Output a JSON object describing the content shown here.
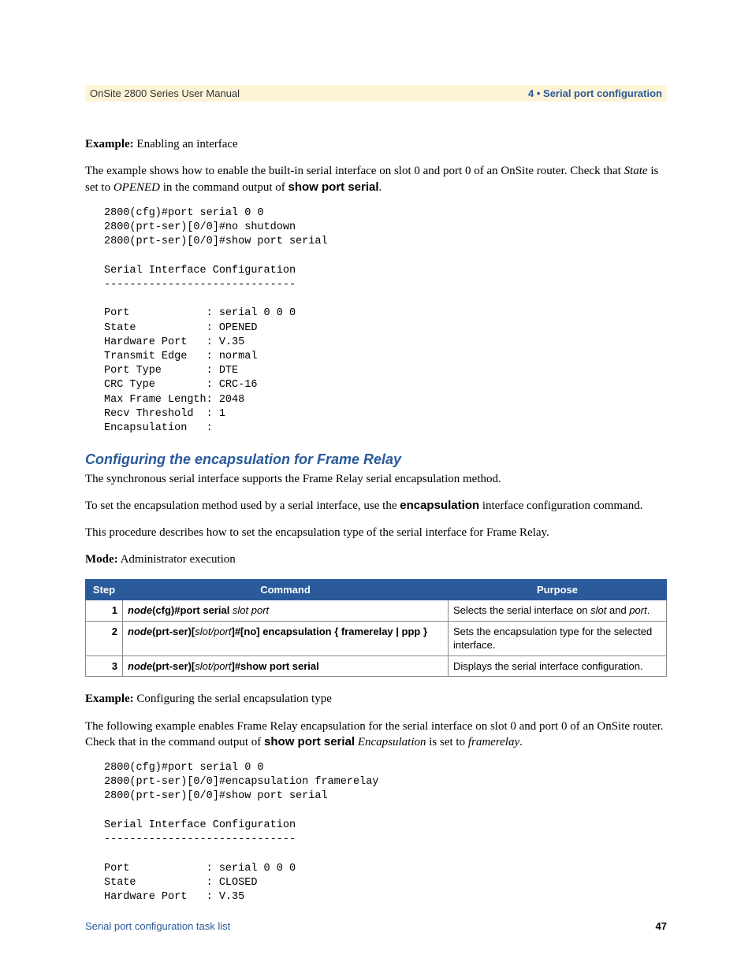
{
  "header": {
    "left": "OnSite 2800 Series User Manual",
    "right": "4 • Serial port configuration"
  },
  "example1": {
    "label": "Example:",
    "title": " Enabling an interface",
    "intro_a": "The example shows how to enable the built-in serial interface on slot 0 and port 0 of an OnSite router. Check that ",
    "state": "State",
    "intro_b": " is set to ",
    "opened": "OPENED",
    "intro_c": " in the command output of ",
    "cmd": "show port serial",
    "intro_d": "."
  },
  "code1": "2800(cfg)#port serial 0 0\n2800(prt-ser)[0/0]#no shutdown\n2800(prt-ser)[0/0]#show port serial\n\nSerial Interface Configuration\n------------------------------\n\nPort            : serial 0 0 0\nState           : OPENED\nHardware Port   : V.35\nTransmit Edge   : normal\nPort Type       : DTE\nCRC Type        : CRC-16\nMax Frame Length: 2048\nRecv Threshold  : 1\nEncapsulation   :",
  "section": {
    "title": "Configuring the encapsulation for Frame Relay",
    "p1": "The synchronous serial interface supports the Frame Relay serial encapsulation method.",
    "p2a": "To set the encapsulation method used by a serial interface, use the ",
    "p2b": "encapsulation",
    "p2c": " interface configuration command.",
    "p3": "This procedure describes how to set the encapsulation type of the serial interface for Frame Relay.",
    "mode_label": "Mode:",
    "mode_text": " Administrator execution"
  },
  "table": {
    "headers": {
      "step": "Step",
      "command": "Command",
      "purpose": "Purpose"
    },
    "rows": [
      {
        "step": "1",
        "cmd_parts": {
          "node": "node",
          "t1": "(cfg)#",
          "t2": "port serial ",
          "arg": "slot port"
        },
        "purpose_a": "Selects the serial interface on ",
        "purpose_slot": "slot",
        "purpose_b": " and ",
        "purpose_port": "port",
        "purpose_c": "."
      },
      {
        "step": "2",
        "cmd_parts": {
          "node": "node",
          "t1": "(prt-ser)[",
          "arg1": "slot/port",
          "t2": "]#[no] encapsulation { framerelay | ppp }"
        },
        "purpose": "Sets the encapsulation type for the selected interface."
      },
      {
        "step": "3",
        "cmd_parts": {
          "node": "node",
          "t1": "(prt-ser)[",
          "arg1": "slot/port",
          "t2": "]#show port serial"
        },
        "purpose": "Displays the serial interface configuration."
      }
    ]
  },
  "example2": {
    "label": "Example:",
    "title": " Configuring the serial encapsulation type",
    "intro_a": "The following example enables Frame Relay encapsulation for the serial interface on slot 0 and port 0 of an OnSite router. Check that in the command output of ",
    "cmd": "show port serial",
    "intro_b": " ",
    "encap": "Encapsulation",
    "intro_c": " is set to ",
    "fr": "framerelay",
    "intro_d": "."
  },
  "code2": "2800(cfg)#port serial 0 0\n2800(prt-ser)[0/0]#encapsulation framerelay\n2800(prt-ser)[0/0]#show port serial\n\nSerial Interface Configuration\n------------------------------\n\nPort            : serial 0 0 0\nState           : CLOSED\nHardware Port   : V.35",
  "footer": {
    "left": "Serial port configuration task list",
    "right": "47"
  }
}
